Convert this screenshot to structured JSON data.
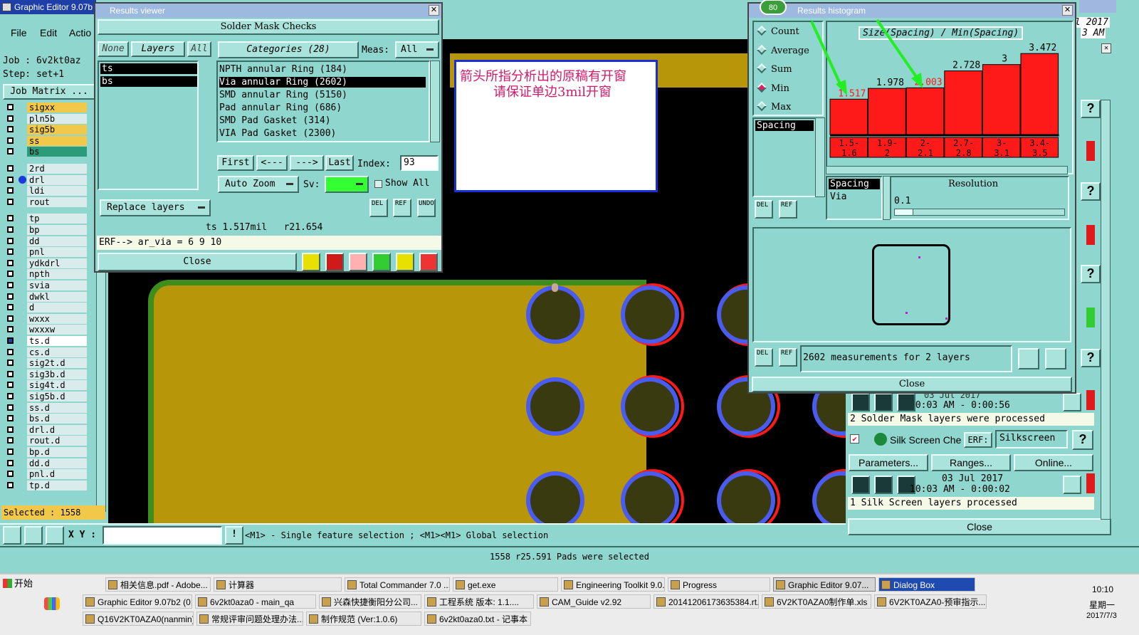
{
  "main_window": {
    "title": "Graphic Editor 9.07b",
    "menu": [
      "File",
      "Edit",
      "Actio"
    ],
    "job": "Job : 6v2kt0az",
    "step": "Step: set+1",
    "job_matrix": "Job Matrix ...",
    "selected": "Selected : 1558",
    "layers": [
      "sigxx",
      "pln5b",
      "sig5b",
      "ss",
      "bs",
      "2rd",
      "drl",
      "ldi",
      "rout",
      "tp",
      "bp",
      "dd",
      "pnl",
      "ydkdrl",
      "npth",
      "svia",
      "dwkl",
      "d",
      "wxxx",
      "wxxxw",
      "ts.d",
      "cs.d",
      "sig2t.d",
      "sig3b.d",
      "sig4t.d",
      "sig5b.d",
      "ss.d",
      "bs.d",
      "drl.d",
      "rout.d",
      "bp.d",
      "dd.d",
      "pnl.d",
      "tp.d"
    ],
    "xy_label": "X Y :",
    "mouse_hint": "<M1> - Single feature selection ; <M1><M1> Global selection",
    "status": "1558 r25.591 Pads were selected"
  },
  "results_viewer": {
    "title": "Results viewer",
    "header": "Solder Mask Checks",
    "tabs": [
      "None",
      "Layers",
      "All"
    ],
    "layers": [
      "ts",
      "bs"
    ],
    "categories_label": "Categories (28)",
    "meas_label": "Meas:",
    "meas_value": "All",
    "categories": [
      "NPTH annular Ring (184)",
      "Via annular Ring (2602)",
      "SMD annular Ring (5150)",
      "Pad annular Ring (686)",
      "SMD Pad Gasket (314)",
      "VIA Pad Gasket (2300)"
    ],
    "nav": [
      "First",
      "<---",
      "--->",
      "Last"
    ],
    "index_label": "Index:",
    "index_value": "93",
    "auto_zoom": "Auto Zoom",
    "sv_label": "Sv:",
    "show_all": "Show All",
    "replace_layers": "Replace layers",
    "small_buttons": [
      "DEL",
      "REF",
      "UNDO"
    ],
    "measure": "ts 1.517mil   r21.654",
    "erf": "ERF--> ar_via = 6 9 10",
    "close": "Close"
  },
  "annotation": {
    "line1": "箭头所指分析出的原稿有开窗",
    "line2": "请保证单边3mil开窗"
  },
  "histogram": {
    "title": "Results histogram",
    "badge": "80",
    "radio": [
      "Count",
      "Average",
      "Sum",
      "Min",
      "Max"
    ],
    "selected_radio": "Min",
    "chart_title": "Size(Spacing) / Min(Spacing)",
    "list_items": [
      "Spacing"
    ],
    "spacing_via": [
      "Spacing",
      "Via"
    ],
    "resolution_label": "Resolution",
    "resolution_value": "0.1",
    "measurements": "2602 measurements for 2 layers",
    "close": "Close",
    "small_buttons": [
      "DEL",
      "REF"
    ]
  },
  "chart_data": {
    "type": "bar",
    "title": "Size(Spacing) / Min(Spacing)",
    "categories": [
      "1.5-1.6",
      "1.9-2",
      "2-2.1",
      "2.7-2.8",
      "3-3.1",
      "3.4-3.5"
    ],
    "values": [
      1.517,
      1.978,
      2.003,
      2.728,
      3,
      3.472
    ],
    "value_labels": [
      "1.517",
      "1.978",
      "2.003",
      "2.728",
      "3",
      "3.472"
    ],
    "highlight": [
      "1.517",
      "2.003"
    ],
    "bar_color": "#ff1a1a"
  },
  "right_panel": {
    "clock_top": "l 2017",
    "clock_top2": "3 AM",
    "row1_date": "03 Jul 2017",
    "row1_time": "10:03 AM - 0:00:56",
    "row1_msg": "2 Solder Mask layers were processed",
    "silk_label": "Silk Screen Che",
    "erf_label": "ERF:",
    "erf_value": "Silkscreen",
    "params": "Parameters...",
    "ranges": "Ranges...",
    "online": "Online...",
    "row2_date": "03 Jul 2017",
    "row2_time": "10:03 AM - 0:00:02",
    "row2_msg": "1 Silk Screen layers processed",
    "close": "Close"
  },
  "taskbar": {
    "start": "开始",
    "clock": "10:10",
    "weekday": "星期一",
    "date": "2017/7/3",
    "row1": [
      "相关信息.pdf - Adobe...",
      "计算器",
      "Total Commander 7.0 ...",
      "get.exe",
      "Engineering Toolkit 9.0...",
      "Progress",
      "Graphic Editor 9.07...",
      "Dialog Box"
    ],
    "row2": [
      "Graphic Editor 9.07b2 (0...",
      "6v2kt0aza0 - main_qa",
      "兴森快捷衡阳分公司...",
      "工程系统  版本: 1.1....",
      "CAM_Guide v2.92",
      "20141206173635384.rt...",
      "6V2KT0AZA0制作单.xls ...",
      "6V2KT0AZA0-预审指示..."
    ],
    "row3": [
      "Q16V2KT0AZA0(nanmin)...",
      "常规评审问题处理办法...",
      "制作规范 (Ver:1.0.6)",
      "6v2kt0aza0.txt - 记事本"
    ]
  },
  "colors": {
    "cyan": "#8fd6cf",
    "copper": "#b8960a",
    "red": "#ff1a1a",
    "blue": "#4a5cf0",
    "green": "#33ff33"
  }
}
